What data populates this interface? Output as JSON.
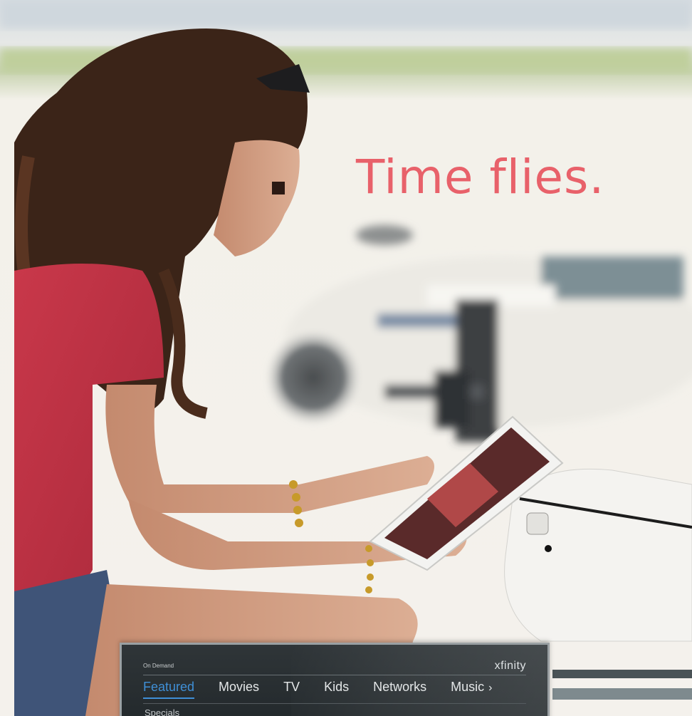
{
  "ad": {
    "headline": "Time flies.",
    "headline_color": "#e8616a"
  },
  "xfinity_ui": {
    "section_label": "On Demand",
    "brand": "xfinity",
    "nav_items": [
      "Featured",
      "Movies",
      "TV",
      "Kids",
      "Networks",
      "Music"
    ],
    "active_item": "Featured",
    "more_icon": "chevron-right-icon",
    "sub_label": "Specials",
    "accent_color": "#3f8fd6"
  }
}
